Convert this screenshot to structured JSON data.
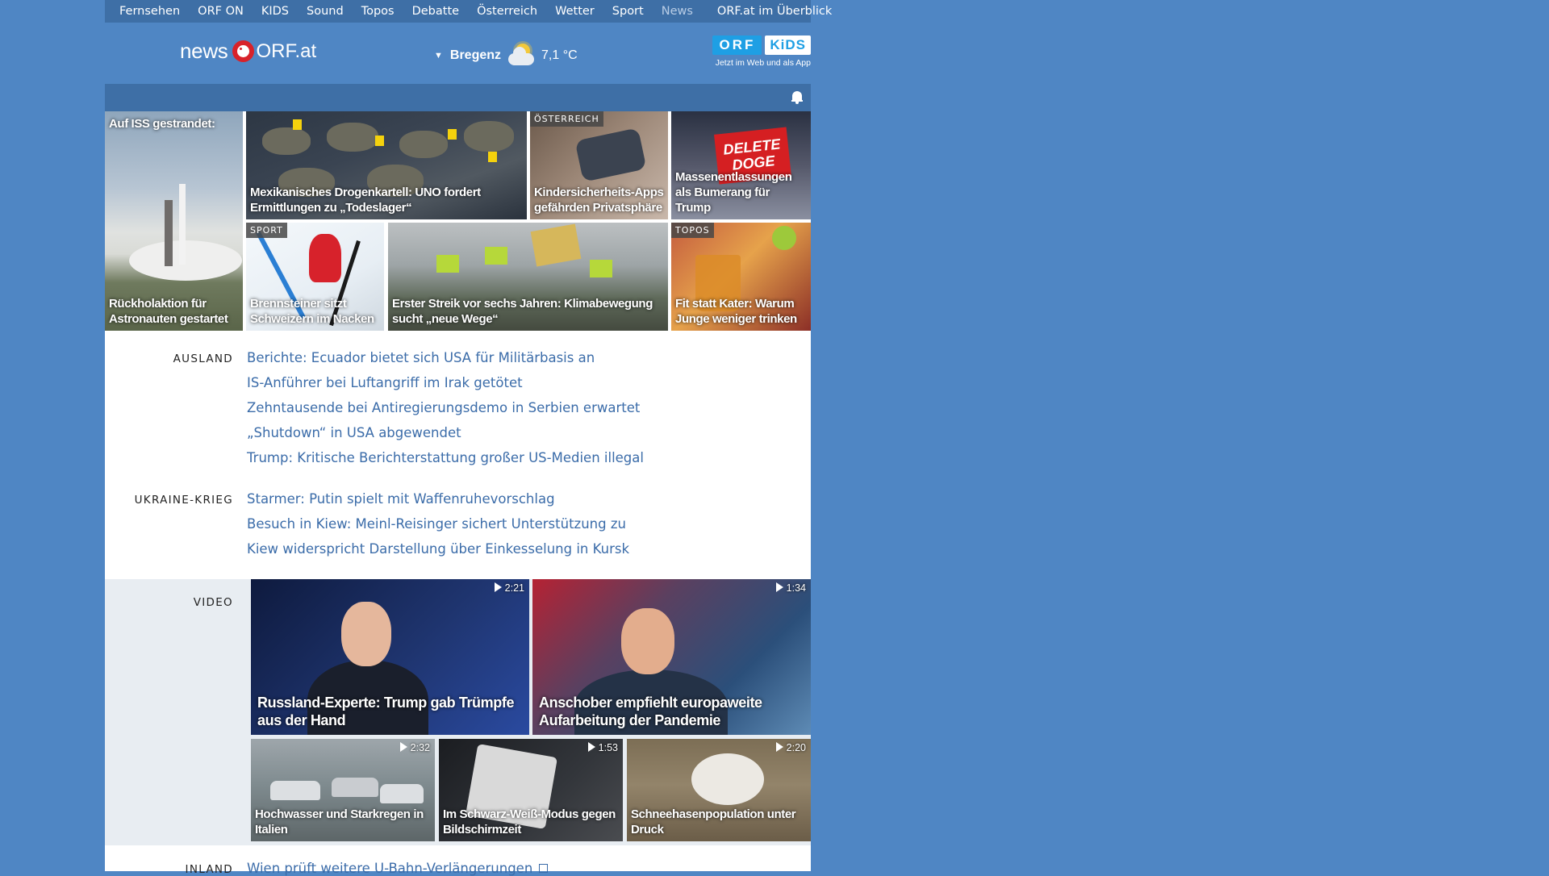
{
  "topnav": {
    "items": [
      "Fernsehen",
      "ORF ON",
      "KIDS",
      "Sound",
      "Topos",
      "Debatte",
      "Österreich",
      "Wetter",
      "Sport",
      "News"
    ],
    "overview": "ORF.at im Überblick"
  },
  "header": {
    "logo_news": "news",
    "logo_orf": "ORF.at",
    "weather": {
      "caret": "▼",
      "city": "Bregenz",
      "temp": "7,1 °C",
      "icon": "partly-cloudy-icon"
    },
    "kids": {
      "orf": "ORF",
      "kids": "KiDS",
      "tagline": "Jetzt im Web und als App"
    }
  },
  "alertbar": {
    "icon": "bell-icon"
  },
  "tiles": [
    {
      "caption_top": "Auf ISS gestrandet:",
      "caption": "Rückholaktion für Astronauten gestartet"
    },
    {
      "caption": "Mexikanisches Drogenkartell: UNO fordert Ermittlungen zu „Todeslager“"
    },
    {
      "badge": "ÖSTERREICH",
      "caption": "Kindersicherheits-Apps gefährden Privatsphäre"
    },
    {
      "caption": "Massenentlassungen als Bumerang für Trump",
      "sign": "DELETE DOGE"
    },
    {
      "badge": "SPORT",
      "caption": "Brennsteiner sitzt Schweizern im Nacken"
    },
    {
      "caption": "Erster Streik vor sechs Jahren: Klimabewegung sucht „neue Wege“"
    },
    {
      "badge": "TOPOS",
      "caption": "Fit statt Kater: Warum Junge weniger trinken"
    }
  ],
  "sections": [
    {
      "label": "AUSLAND",
      "links": [
        "Berichte: Ecuador bietet sich USA für Militärbasis an",
        "IS-Anführer bei Luftangriff im Irak getötet",
        "Zehntausende bei Antiregierungsdemo in Serbien erwartet",
        "„Shutdown“ in USA abgewendet",
        "Trump: Kritische Berichterstattung großer US-Medien illegal"
      ]
    },
    {
      "label": "UKRAINE-KRIEG",
      "links": [
        "Starmer: Putin spielt mit Waffenruhevorschlag",
        "Besuch in Kiew: Meinl-Reisinger sichert Unterstützung zu",
        "Kiew widerspricht Darstellung über Einkesselung in Kursk"
      ]
    }
  ],
  "video": {
    "label": "VIDEO",
    "items": [
      {
        "duration": "2:21",
        "caption": "Russland-Experte: Trump gab Trümpfe aus der Hand"
      },
      {
        "duration": "1:34",
        "caption": "Anschober empfiehlt europaweite Aufarbeitung der Pandemie"
      },
      {
        "duration": "2:32",
        "caption": "Hochwasser und Starkregen in Italien"
      },
      {
        "duration": "1:53",
        "caption": "Im Schwarz-Weiß-Modus gegen Bildschirmzeit"
      },
      {
        "duration": "2:20",
        "caption": "Schneehasenpopulation unter Druck"
      }
    ]
  },
  "inland": {
    "label": "INLAND",
    "link": "Wien prüft weitere U-Bahn-Verlängerungen"
  }
}
